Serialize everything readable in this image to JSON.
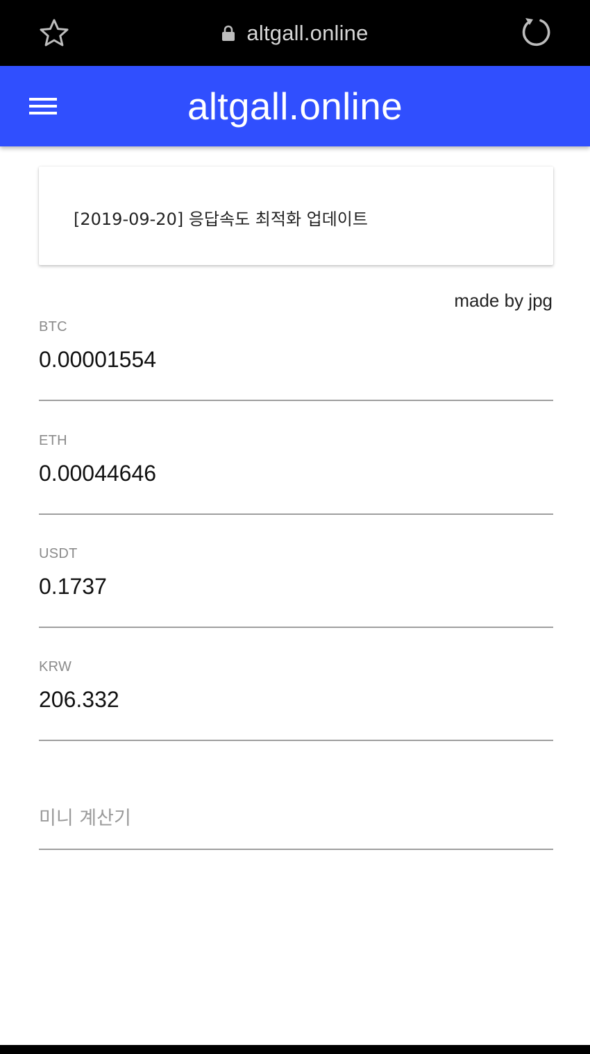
{
  "browser": {
    "url": "altgall.online",
    "icons": [
      "star-icon",
      "lock-icon",
      "reload-icon"
    ]
  },
  "app_bar": {
    "title": "altgall.online",
    "menu_icon": "hamburger-menu-icon",
    "color": "#304ffe"
  },
  "notice": {
    "text": "[2019-09-20] 응답속도 최적화 업데이트"
  },
  "credit": "made by jpg",
  "fields": [
    {
      "label": "BTC",
      "value": "0.00001554"
    },
    {
      "label": "ETH",
      "value": "0.00044646"
    },
    {
      "label": "USDT",
      "value": "0.1737"
    },
    {
      "label": "KRW",
      "value": "206.332"
    }
  ],
  "calculator": {
    "placeholder": "미니 계산기",
    "value": ""
  }
}
